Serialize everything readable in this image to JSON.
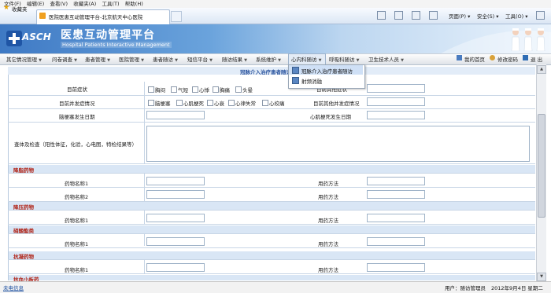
{
  "browser": {
    "menubar": [
      "文件(F)",
      "编辑(E)",
      "查看(V)",
      "收藏夹(A)",
      "工具(T)",
      "帮助(H)"
    ],
    "favorites_label": "收藏夹",
    "tab_title": "医院医患互动管理平台-北京航天中心医院",
    "cmd_page": "页面(P)",
    "cmd_safety": "安全(S)",
    "cmd_tools": "工具(O)"
  },
  "app": {
    "logo_text": "ASCH",
    "title_cn": "医患互动管理平台",
    "title_en": "Hospital Patients Interactive Management"
  },
  "nav": {
    "items": [
      "其它情况管理",
      "问卷调查",
      "患者管理",
      "医院管理",
      "患者随访",
      "短信平台",
      "随访结果",
      "系统维护",
      "心内科随访",
      "呼吸科随访",
      "卫生技术人员"
    ],
    "my_home": "我的首页",
    "change_password": "修改密码",
    "logout": "退 出"
  },
  "dropdown": {
    "items": [
      "冠脉介入治疗患者随访",
      "射频消融"
    ]
  },
  "form": {
    "title": "冠脉介入治疗患者随访",
    "rows": {
      "current_symptoms": "目前症状",
      "symptoms_options": [
        "胸闷",
        "气短",
        "心悸",
        "胸痛",
        "头晕"
      ],
      "other_symptoms": "目前其他症状",
      "complications": "目前并发症情况",
      "complication_options": [
        "脑梗塞",
        "心肌梗死",
        "心衰",
        "心律失常",
        "心绞痛"
      ],
      "other_complications": "目前其他并发症情况",
      "cerebral_infarction_date": "脑梗塞发生日期",
      "mi_date": "心肌梗死发生日期",
      "exam": "查体及检查（阳性体征，化验，心电图，特检结果等）"
    },
    "sections": [
      {
        "title": "降脂药物",
        "drug_labels": [
          "药物名称1",
          "药物名称2"
        ],
        "method_labels": [
          "用药方法",
          "用药方法"
        ]
      },
      {
        "title": "降压药物",
        "drug_labels": [
          "药物名称1"
        ],
        "method_labels": [
          "用药方法"
        ]
      },
      {
        "title": "硝酸酯类",
        "drug_labels": [
          "药物名称1"
        ],
        "method_labels": [
          "用药方法"
        ]
      },
      {
        "title": "抗凝药物",
        "drug_labels": [
          "药物名称1"
        ],
        "method_labels": [
          "用药方法"
        ]
      },
      {
        "title": "抗血小板药",
        "drug_labels": [],
        "method_labels": []
      }
    ]
  },
  "status": {
    "left_link": "未电信息",
    "user": "用户：随访管理员",
    "date": "2012年9月4日 星期二"
  }
}
